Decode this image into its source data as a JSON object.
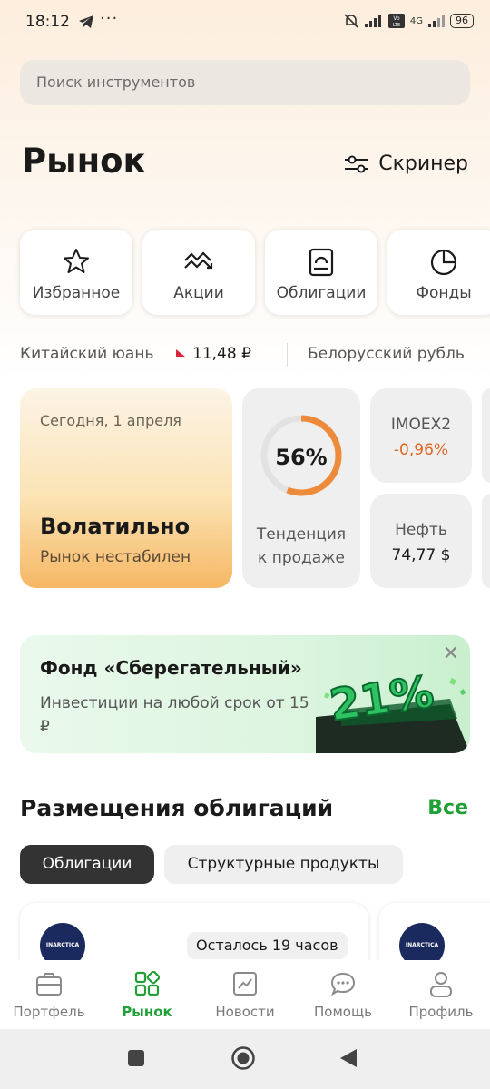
{
  "status_bar": {
    "time": "18:12",
    "dots": "···",
    "battery": "96",
    "network": "4G"
  },
  "search": {
    "placeholder": "Поиск инструментов"
  },
  "header": {
    "title": "Рынок",
    "screener_label": "Скринер"
  },
  "categories": [
    {
      "label": "Избранное",
      "icon": "star-icon"
    },
    {
      "label": "Акции",
      "icon": "stocks-trend-icon"
    },
    {
      "label": "Облигации",
      "icon": "bond-icon"
    },
    {
      "label": "Фонды",
      "icon": "pie-chart-icon"
    }
  ],
  "ticker": {
    "items": [
      {
        "name": "Китайский юань",
        "value": "11,48 ₽",
        "direction": "down"
      },
      {
        "name": "Белорусский рубль"
      }
    ]
  },
  "market_mood": {
    "date": "Сегодня, 1 апреля",
    "headline": "Волатильно",
    "subtitle": "Рынок нестабилен"
  },
  "trend": {
    "percent_label": "56%",
    "percent": 56,
    "label_line1": "Тенденция",
    "label_line2": "к продаже"
  },
  "indices": [
    {
      "name": "IMOEX2",
      "value": "-0,96%",
      "color": "#e0651f"
    },
    {
      "name": "Нефть",
      "value": "74,77 $",
      "color": "#1a1a1a"
    }
  ],
  "promo": {
    "title": "Фонд «Сберегательный»",
    "description": "Инвестиции на любой срок от 15 ₽",
    "art_text": "21%"
  },
  "placements": {
    "title": "Размещения облигаций",
    "all_label": "Все",
    "chips": [
      "Облигации",
      "Структурные продукты"
    ],
    "cards": [
      {
        "logo_text": "INARCTICA",
        "badge": "Осталось 19 часов"
      },
      {
        "logo_text": "INARCTICA"
      }
    ]
  },
  "nav": [
    {
      "label": "Портфель",
      "icon": "briefcase-icon",
      "active": false
    },
    {
      "label": "Рынок",
      "icon": "market-grid-icon",
      "active": true
    },
    {
      "label": "Новости",
      "icon": "news-chart-icon",
      "active": false
    },
    {
      "label": "Помощь",
      "icon": "chat-help-icon",
      "active": false
    },
    {
      "label": "Профиль",
      "icon": "profile-icon",
      "active": false
    }
  ],
  "colors": {
    "accent": "#21a038",
    "negative": "#e0651f",
    "ring": "#ee8b3a"
  }
}
